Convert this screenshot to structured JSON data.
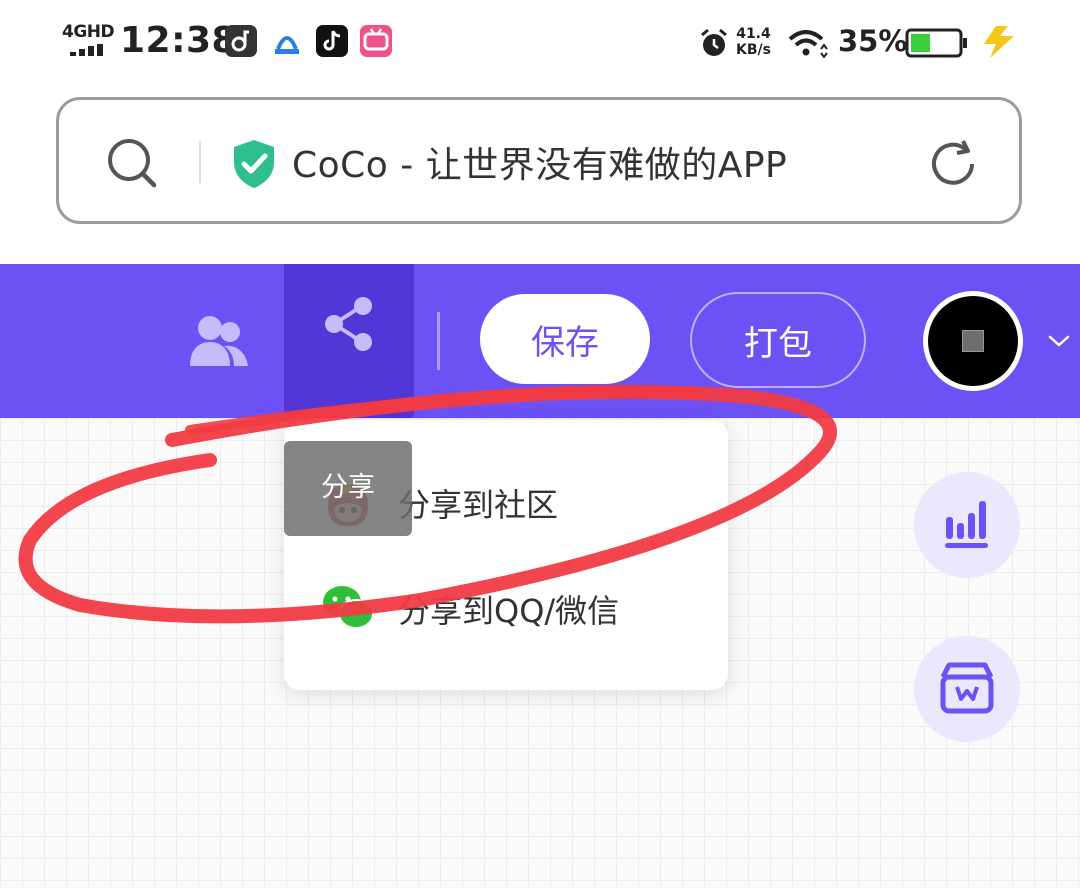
{
  "status_bar": {
    "network": "4GHD",
    "time": "12:38",
    "speed_value": "41.4",
    "speed_unit": "KB/s",
    "battery": "35%",
    "app_icons": [
      "music-app-icon",
      "map-app-icon",
      "tiktok-icon",
      "bilibili-icon"
    ]
  },
  "address_bar": {
    "title": "CoCo - 让世界没有难做的APP",
    "secure_icon": "shield-check-icon",
    "search_icon": "search-icon",
    "reload_icon": "refresh-icon"
  },
  "toolbar": {
    "collaborators_icon": "users-icon",
    "share_icon": "share-icon",
    "save_label": "保存",
    "pack_label": "打包",
    "avatar_icon": "avatar",
    "dropdown_icon": "chevron-down-icon"
  },
  "share_menu": {
    "tooltip": "分享",
    "items": [
      {
        "label": "分享到社区",
        "icon": "community-mascot-icon"
      },
      {
        "label": "分享到QQ/微信",
        "icon": "wechat-icon"
      }
    ]
  },
  "side_buttons": [
    {
      "icon": "bar-chart-icon"
    },
    {
      "icon": "toolbox-icon"
    }
  ],
  "colors": {
    "toolbar_bg": "#6c52f5",
    "share_active_bg": "#5236d6",
    "fab_bg": "#ebe7fd",
    "annotation_stroke": "#f23b44",
    "shield_green": "#2fbf8f"
  }
}
